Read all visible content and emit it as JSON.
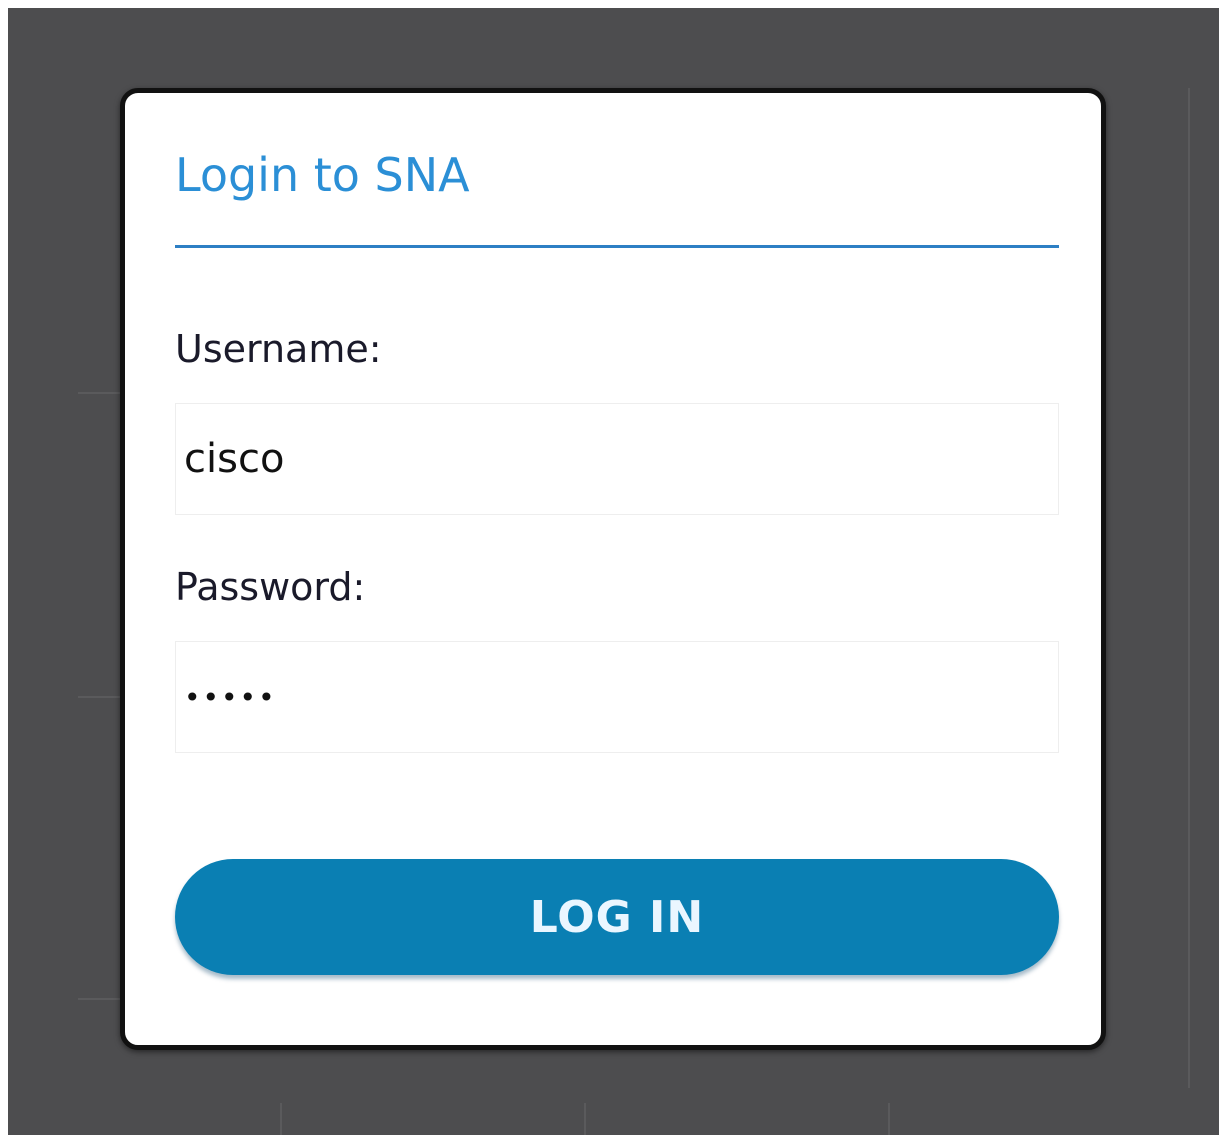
{
  "login": {
    "title": "Login to SNA",
    "username_label": "Username:",
    "username_value": "cisco",
    "password_label": "Password:",
    "password_value": "•••••",
    "submit_label": "LOG IN"
  },
  "colors": {
    "backdrop": "#4d4d4f",
    "title": "#2b8fd6",
    "accent_rule": "#2d7fc4",
    "button": "#0a7fb3",
    "button_text": "#eaf6ff"
  }
}
